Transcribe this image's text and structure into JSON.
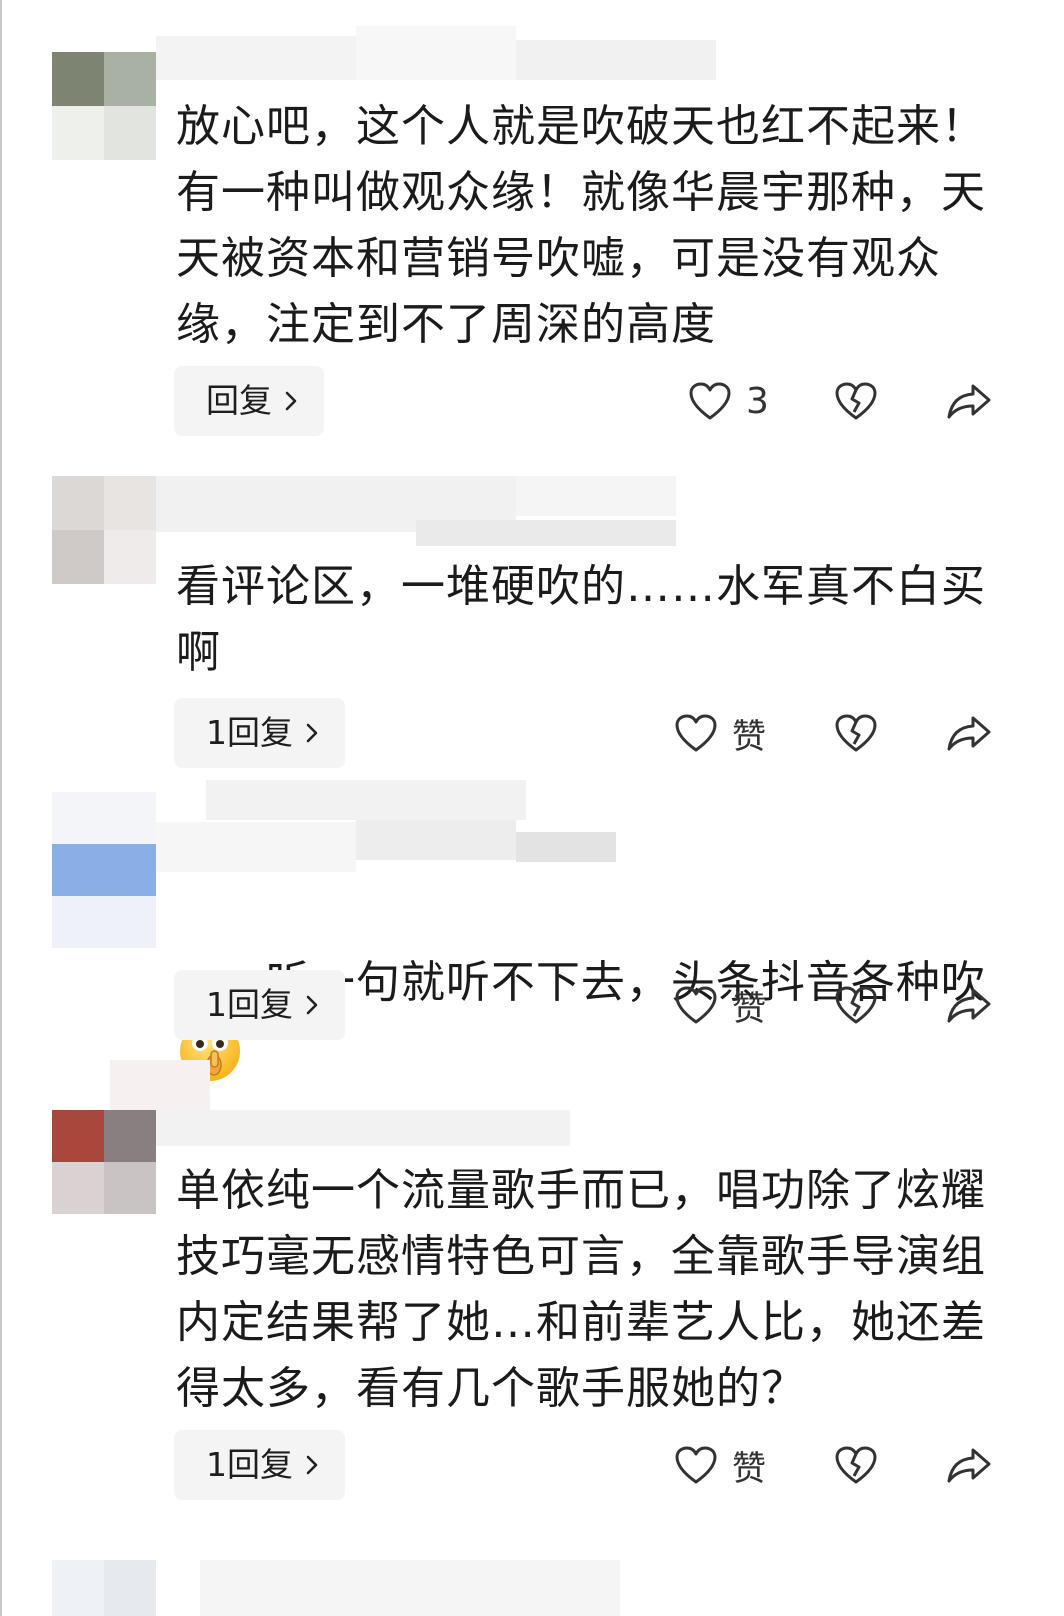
{
  "comments": [
    {
      "text": "放心吧，这个人就是吹破天也红不起来！有一种叫做观众缘！就像华晨宇那种，天天被资本和营销号吹嘘，可是没有观众缘，注定到不了周深的高度",
      "reply_label": "回复",
      "like_label": "3",
      "avatar_colors": [
        "#7d8472",
        "#aab2a6",
        "#e8ece6",
        "#d6dbd3"
      ]
    },
    {
      "text": "看评论区，一堆硬吹的……水军真不白买啊",
      "reply_label": "1回复",
      "like_label": "赞",
      "avatar_colors": [
        "#d9d5d3",
        "#c8c3c0",
        "#ece9e7",
        "#e3dfdd"
      ]
    },
    {
      "text": "听一句就听不下去，头条抖音各种吹",
      "reply_label": "1回复",
      "like_label": "赞",
      "emoji": "shushing-face-emoji",
      "avatar_colors": [
        "#f1f4f7",
        "#e6ebf2",
        "#8aaee6",
        "#e9eef6"
      ]
    },
    {
      "text": "单依纯一个流量歌手而已，唱功除了炫耀技巧毫无感情特色可言，全靠歌手导演组内定结果帮了她…和前辈艺人比，她还差得太多，看有几个歌手服她的？",
      "reply_label": "1回复",
      "like_label": "赞",
      "avatar_colors": [
        "#a8473c",
        "#8a7f80",
        "#d8cfd0",
        "#cfc9ca"
      ]
    }
  ],
  "icons": {
    "like": "heart-outline-icon",
    "dislike": "broken-heart-icon",
    "share": "share-arrow-icon",
    "reply_arrow": "chevron-right-icon"
  },
  "colors": {
    "reply_bg": "#f4f4f4",
    "text": "#1b1b1b",
    "icon": "#333333"
  }
}
